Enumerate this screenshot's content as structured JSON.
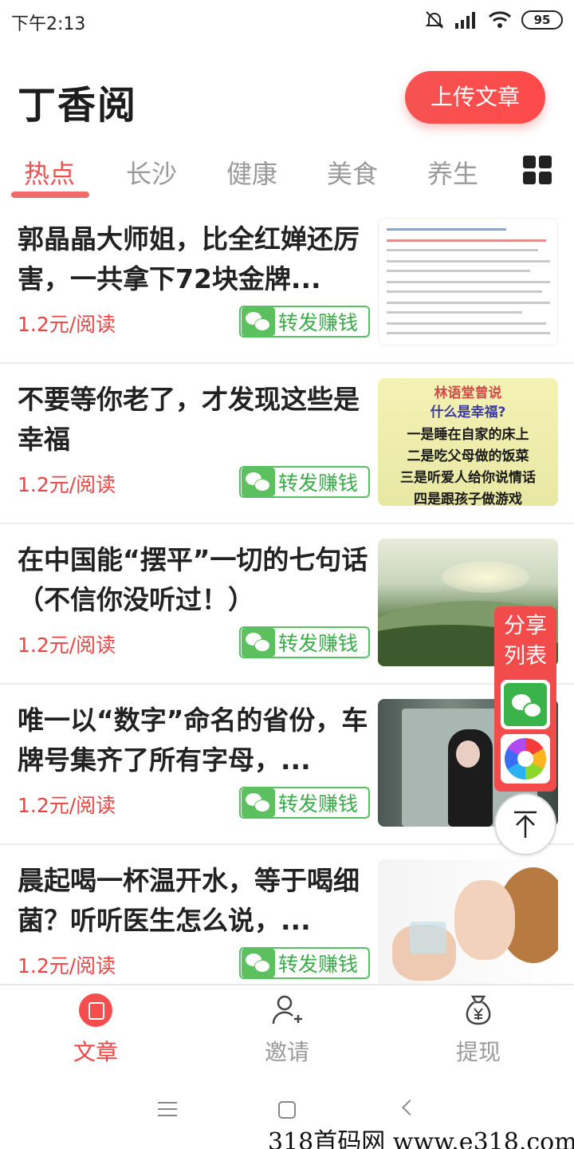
{
  "status_bar": {
    "time": "下午2:13",
    "battery": "95"
  },
  "header": {
    "app_title": "丁香阅",
    "upload_button": "上传文章"
  },
  "tabs": [
    {
      "label": "热点",
      "active": true
    },
    {
      "label": "长沙"
    },
    {
      "label": "健康"
    },
    {
      "label": "美食"
    },
    {
      "label": "养生"
    }
  ],
  "articles": [
    {
      "title": "郭晶晶大师姐，比全红婵还厉害，一共拿下72块金牌...",
      "price": "1.2元/阅读",
      "share_label": "转发赚钱"
    },
    {
      "title": "不要等你老了，才发现这些是幸福",
      "price": "1.2元/阅读",
      "share_label": "转发赚钱",
      "thumb_text": {
        "t1": "林语堂曾说",
        "t2": "什么是幸福?",
        "lines": [
          "一是睡在自家的床上",
          "二是吃父母做的饭菜",
          "三是听爱人给你说情话",
          "四是跟孩子做游戏"
        ]
      }
    },
    {
      "title": "在中国能“摆平”一切的七句话（不信你没听过！）",
      "price": "1.2元/阅读",
      "share_label": "转发赚钱"
    },
    {
      "title": "唯一以“数字”命名的省份，车牌号集齐了所有字母，...",
      "price": "1.2元/阅读",
      "share_label": "转发赚钱"
    },
    {
      "title": "晨起喝一杯温开水，等于喝细菌？听听医生怎么说，...",
      "price": "1.2元/阅读",
      "share_label": "转发赚钱"
    }
  ],
  "share_panel": {
    "title": "分享列表"
  },
  "bottom_nav": [
    {
      "label": "文章",
      "active": true,
      "icon": "article-icon"
    },
    {
      "label": "邀请",
      "icon": "invite-icon"
    },
    {
      "label": "提现",
      "icon": "withdraw-icon"
    }
  ],
  "watermark": "318首码网 www.e318.com",
  "colors": {
    "accent": "#f24e4e",
    "wechat_green": "#56c062",
    "text_gray": "#9a9a9a"
  }
}
